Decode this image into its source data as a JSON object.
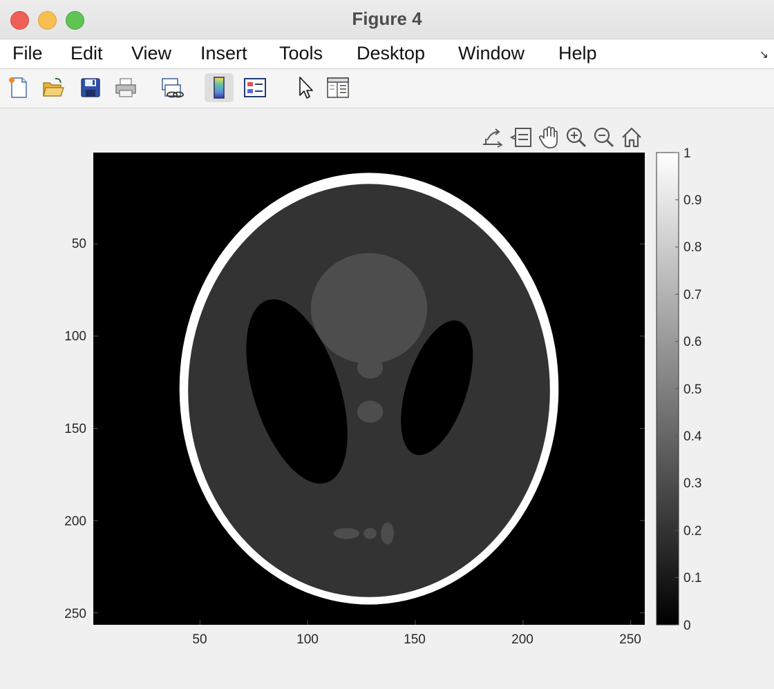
{
  "window": {
    "title": "Figure 4"
  },
  "menu": [
    "File",
    "Edit",
    "View",
    "Insert",
    "Tools",
    "Desktop",
    "Window",
    "Help"
  ],
  "toolbar": [
    {
      "name": "new-figure-icon"
    },
    {
      "name": "open-file-icon"
    },
    {
      "name": "save-icon"
    },
    {
      "name": "print-icon"
    },
    {
      "name": "link-plot-icon"
    },
    {
      "name": "insert-colorbar-icon"
    },
    {
      "name": "insert-legend-icon"
    },
    {
      "name": "edit-plot-icon"
    },
    {
      "name": "property-inspector-icon"
    }
  ],
  "axes_toolbar": [
    "export-icon",
    "data-tips-icon",
    "pan-icon",
    "zoom-in-icon",
    "zoom-out-icon",
    "home-icon"
  ],
  "chart_data": {
    "type": "heatmap",
    "title": "",
    "xlabel": "",
    "ylabel": "",
    "image_size": [
      256,
      256
    ],
    "xlim": [
      0.5,
      256.5
    ],
    "ylim": [
      0.5,
      256.5
    ],
    "y_reversed": true,
    "xticks": [
      50,
      100,
      150,
      200,
      250
    ],
    "yticks": [
      50,
      100,
      150,
      200,
      250
    ],
    "colormap": "gray",
    "clim": [
      0,
      1
    ],
    "colorbar_ticks": [
      "0",
      "0.1",
      "0.2",
      "0.3",
      "0.4",
      "0.5",
      "0.6",
      "0.7",
      "0.8",
      "0.9",
      "1"
    ],
    "background_value": 0,
    "ellipses": [
      {
        "cx": 128.5,
        "cy": 128.5,
        "rx": 88,
        "ry": 117,
        "angle": 0,
        "value": 1.0
      },
      {
        "cx": 128.5,
        "cy": 129.5,
        "rx": 84,
        "ry": 112,
        "angle": 0,
        "value": 0.2
      },
      {
        "cx": 95,
        "cy": 130,
        "rx": 20,
        "ry": 52,
        "angle": -18,
        "value": 0.0
      },
      {
        "cx": 160,
        "cy": 128,
        "rx": 14,
        "ry": 38,
        "angle": 18,
        "value": 0.0
      },
      {
        "cx": 128.5,
        "cy": 85,
        "rx": 27,
        "ry": 30,
        "angle": 0,
        "value": 0.3
      },
      {
        "cx": 129,
        "cy": 117,
        "rx": 6,
        "ry": 6,
        "angle": 0,
        "value": 0.3
      },
      {
        "cx": 129,
        "cy": 141,
        "rx": 6,
        "ry": 6,
        "angle": 0,
        "value": 0.3
      },
      {
        "cx": 118,
        "cy": 207,
        "rx": 6,
        "ry": 3,
        "angle": 0,
        "value": 0.3
      },
      {
        "cx": 129,
        "cy": 207,
        "rx": 3,
        "ry": 3,
        "angle": 0,
        "value": 0.3
      },
      {
        "cx": 137,
        "cy": 207,
        "rx": 3,
        "ry": 6,
        "angle": 0,
        "value": 0.3
      }
    ]
  }
}
